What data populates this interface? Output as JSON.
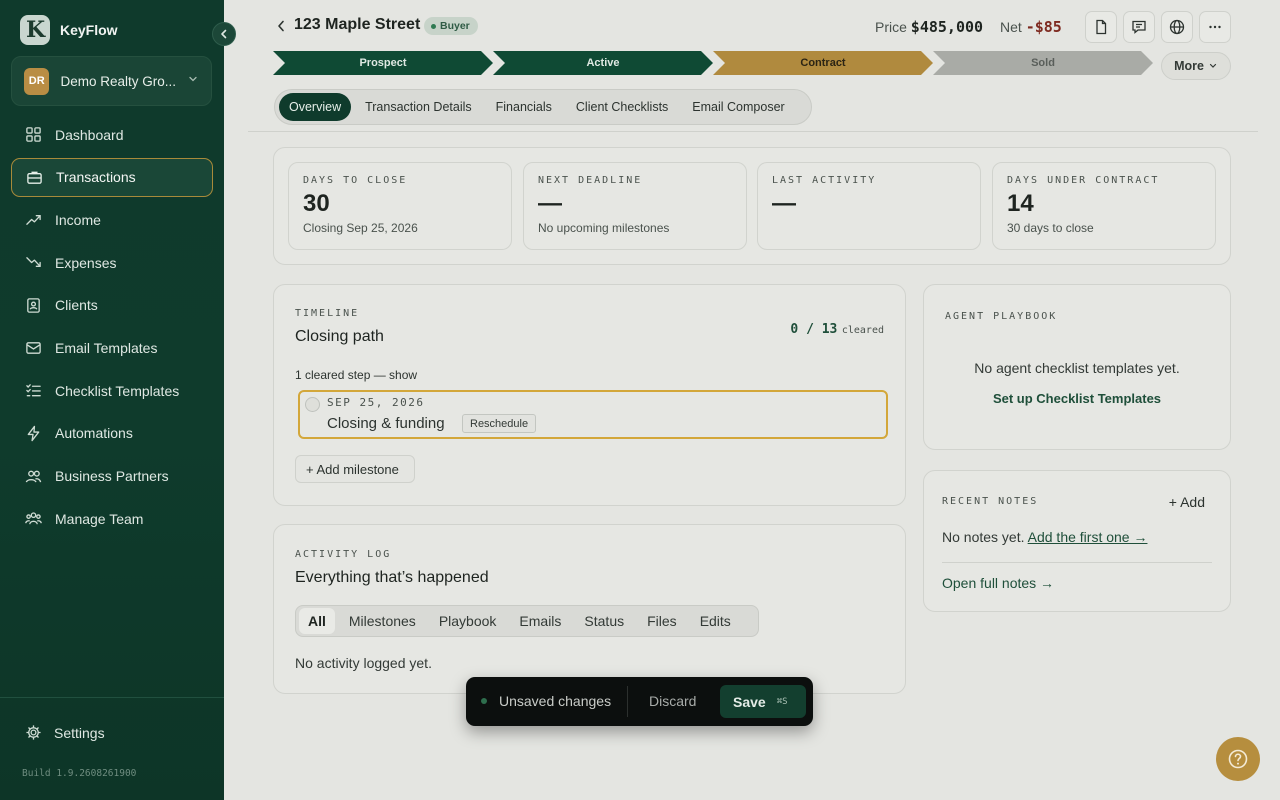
{
  "sidebar": {
    "brand": "KeyFlow",
    "org": {
      "initials": "DR",
      "name": "Demo Realty Gro..."
    },
    "items": [
      {
        "label": "Dashboard",
        "icon": "grid-icon"
      },
      {
        "label": "Transactions",
        "icon": "briefcase-icon",
        "active": true
      },
      {
        "label": "Income",
        "icon": "trend-up-icon"
      },
      {
        "label": "Expenses",
        "icon": "trend-down-icon"
      },
      {
        "label": "Clients",
        "icon": "contacts-icon"
      },
      {
        "label": "Email Templates",
        "icon": "mail-icon"
      },
      {
        "label": "Checklist Templates",
        "icon": "checklist-icon"
      },
      {
        "label": "Automations",
        "icon": "bolt-icon"
      },
      {
        "label": "Business Partners",
        "icon": "partners-icon"
      },
      {
        "label": "Manage Team",
        "icon": "team-icon"
      }
    ],
    "settings": "Settings",
    "build": "Build 1.9.2608261900"
  },
  "header": {
    "title": "123 Maple Street",
    "badge": "Buyer",
    "price_label": "Price",
    "price_value": "$485,000",
    "net_label": "Net",
    "net_value": "-$85"
  },
  "stages": {
    "items": [
      {
        "label": "Prospect",
        "state": "done",
        "color": "#0f4a34"
      },
      {
        "label": "Active",
        "state": "done",
        "color": "#0f4a34"
      },
      {
        "label": "Contract",
        "state": "current",
        "color": "#b08a3e"
      },
      {
        "label": "Sold",
        "state": "pending",
        "color": "#a9aba6"
      }
    ],
    "more": "More"
  },
  "tabs": [
    "Overview",
    "Transaction Details",
    "Financials",
    "Client Checklists",
    "Email Composer"
  ],
  "stats": [
    {
      "label": "DAYS TO CLOSE",
      "value": "30",
      "sub": "Closing Sep 25, 2026"
    },
    {
      "label": "NEXT DEADLINE",
      "value": "—",
      "sub": "No upcoming milestones"
    },
    {
      "label": "LAST ACTIVITY",
      "value": "—",
      "sub": ""
    },
    {
      "label": "DAYS UNDER CONTRACT",
      "value": "14",
      "sub": "30 days to close"
    }
  ],
  "timeline": {
    "label": "TIMELINE",
    "title": "Closing path",
    "count": "0 / 13",
    "count_suffix": "cleared",
    "cleared_note": "1 cleared step — show",
    "milestone": {
      "date": "SEP 25, 2026",
      "name": "Closing & funding",
      "action": "Reschedule"
    },
    "add": "+ Add milestone"
  },
  "playbook": {
    "label": "AGENT PLAYBOOK",
    "empty": "No agent checklist templates yet.",
    "link": "Set up Checklist Templates"
  },
  "notes": {
    "label": "RECENT NOTES",
    "add": "+ Add",
    "empty": "No notes yet.",
    "first_link": "Add the first one →",
    "open": "Open full notes →"
  },
  "activity": {
    "label": "ACTIVITY LOG",
    "title": "Everything that’s happened",
    "filters": [
      "All",
      "Milestones",
      "Playbook",
      "Emails",
      "Status",
      "Files",
      "Edits"
    ],
    "empty": "No activity logged yet."
  },
  "savebar": {
    "text": "Unsaved changes",
    "discard": "Discard",
    "save": "Save",
    "shortcut": "⌘S"
  },
  "colors": {
    "brand": "#0f3b2c",
    "accent": "#b08a3e",
    "negative": "#7e2a20"
  }
}
